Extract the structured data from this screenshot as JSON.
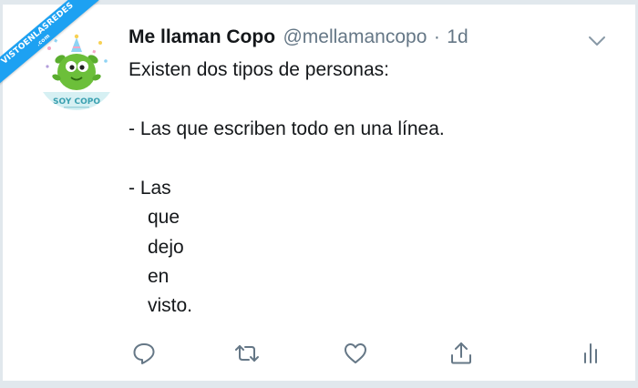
{
  "watermark": {
    "main": "VISTOENLASREDES",
    "sub": ".com"
  },
  "avatar": {
    "label": "SOY COPO",
    "icon": "green-monster-avatar"
  },
  "tweet": {
    "display_name": "Me llaman Copo",
    "handle": "@mellamancopo",
    "separator": "·",
    "time": "1d",
    "lines": [
      "Existen dos tipos de personas:",
      "- Las que escriben todo en una línea.",
      "- Las",
      "que",
      "dejo",
      "en",
      "visto."
    ]
  },
  "actions": [
    {
      "name": "reply",
      "icon": "reply-icon"
    },
    {
      "name": "retweet",
      "icon": "retweet-icon"
    },
    {
      "name": "like",
      "icon": "heart-icon"
    },
    {
      "name": "share",
      "icon": "share-icon"
    },
    {
      "name": "analytics",
      "icon": "analytics-icon"
    }
  ],
  "colors": {
    "background": "#e1e8ed",
    "text": "#14171a",
    "secondary": "#657786",
    "accent": "#1da1f2",
    "avatar_green": "#6cbf3a"
  }
}
